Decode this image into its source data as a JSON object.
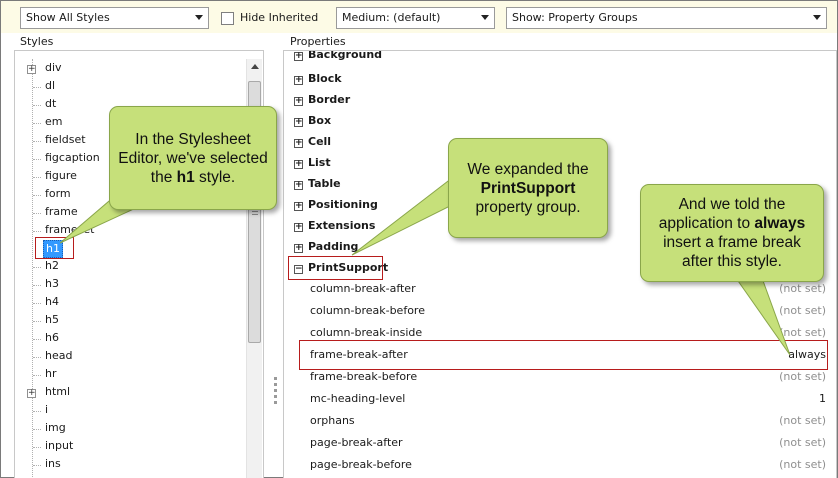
{
  "toolbar": {
    "styles_filter": "Show All Styles",
    "hide_inherited_label": "Hide Inherited",
    "medium": "Medium: (default)",
    "show_mode": "Show: Property Groups"
  },
  "styles_panel": {
    "title": "Styles",
    "items": [
      "div",
      "dl",
      "dt",
      "em",
      "fieldset",
      "figcaption",
      "figure",
      "form",
      "frame",
      "frameset",
      "h1",
      "h2",
      "h3",
      "h4",
      "h5",
      "h6",
      "head",
      "hr",
      "html",
      "i",
      "img",
      "input",
      "ins"
    ],
    "selected": "h1"
  },
  "properties_panel": {
    "title": "Properties",
    "truncated_top": "Background",
    "groups": [
      "Block",
      "Border",
      "Box",
      "Cell",
      "List",
      "Table",
      "Positioning",
      "Extensions",
      "Padding"
    ],
    "expanded_group": "PrintSupport",
    "properties": [
      {
        "name": "column-break-after",
        "value": "(not set)"
      },
      {
        "name": "column-break-before",
        "value": "(not set)"
      },
      {
        "name": "column-break-inside",
        "value": "(not set)"
      },
      {
        "name": "frame-break-after",
        "value": "always"
      },
      {
        "name": "frame-break-before",
        "value": "(not set)"
      },
      {
        "name": "mc-heading-level",
        "value": "1"
      },
      {
        "name": "orphans",
        "value": "(not set)"
      },
      {
        "name": "page-break-after",
        "value": "(not set)"
      },
      {
        "name": "page-break-before",
        "value": "(not set)"
      }
    ]
  },
  "callouts": {
    "c1": {
      "before": "In the Stylesheet Editor, we've selected the ",
      "bold": "h1",
      "after": " style."
    },
    "c2": {
      "before": "We expanded the ",
      "bold": "PrintSupport",
      "after": " property group."
    },
    "c3": {
      "before": "And we told the application to ",
      "bold": "always",
      "after": " insert a frame break after this style."
    }
  },
  "colors": {
    "toolbar_bg": "#fdfbe6",
    "callout_bg": "#c6e07a",
    "highlight_red": "#b71c1c",
    "selection_blue": "#3399ff"
  },
  "icons": {
    "dropdown_arrow": "chevron-down-icon",
    "tree_expand": "plus-box-icon",
    "group_collapse": "minus-box-icon"
  }
}
